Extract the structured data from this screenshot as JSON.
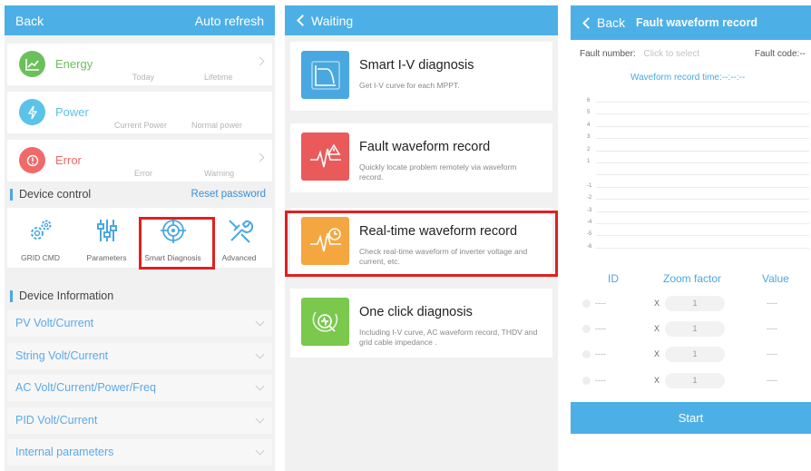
{
  "panel1": {
    "back": "Back",
    "auto_refresh": "Auto refresh",
    "cards": [
      {
        "title": "Energy",
        "sub1": "Today",
        "sub2": "Lifetime",
        "color": "#6cc05c"
      },
      {
        "title": "Power",
        "sub1": "Current Power",
        "sub2": "Normal power",
        "color": "#5bc3e8"
      },
      {
        "title": "Error",
        "sub1": "Error",
        "sub2": "Warning",
        "color": "#f06a6a"
      }
    ],
    "device_control": "Device control",
    "reset_password": "Reset password",
    "tools": [
      {
        "label": "GRID CMD",
        "icon": "gear-icon"
      },
      {
        "label": "Parameters",
        "icon": "sliders-icon"
      },
      {
        "label": "Smart Diagnosis",
        "icon": "target-icon"
      },
      {
        "label": "Advanced",
        "icon": "wrench-icon"
      }
    ],
    "device_information": "Device Information",
    "info_rows": [
      "PV Volt/Current",
      "String Volt/Current",
      "AC Volt/Current/Power/Freq",
      "PID Volt/Current",
      "Internal parameters"
    ]
  },
  "panel2": {
    "back": "Waiting",
    "items": [
      {
        "title": "Smart I-V diagnosis",
        "desc": "Get I-V curve for each MPPT.",
        "color": "#4aa8e0",
        "icon": "iv-curve-icon"
      },
      {
        "title": "Fault waveform record",
        "desc": "Quickly locate problem remotely via waveform record.",
        "color": "#ea5a5a",
        "icon": "fault-waveform-icon"
      },
      {
        "title": "Real-time waveform record",
        "desc": "Check real-time waveform of inverter voltage and current, etc.",
        "color": "#f4a640",
        "icon": "realtime-waveform-icon"
      },
      {
        "title": "One click diagnosis",
        "desc": "Including I-V curve, AC waveform record, THDV and grid cable impedance .",
        "color": "#7ac84c",
        "icon": "search-icon"
      }
    ]
  },
  "panel3": {
    "back": "Back",
    "title": "Fault waveform record",
    "fault_number_label": "Fault number:",
    "fault_number_placeholder": "Click to select",
    "fault_code_label": "Fault code:--",
    "waveform_time": "Waveform record time:--:--:--",
    "y_ticks": [
      "6",
      "5",
      "4",
      "3",
      "2",
      "1",
      "",
      "-1",
      "-2",
      "-3",
      "-4",
      "-5",
      "-6"
    ],
    "col_id": "ID",
    "col_zoom": "Zoom factor",
    "col_value": "Value",
    "rows": [
      {
        "id": "----",
        "x": "X",
        "zoom": "1",
        "value": "----"
      },
      {
        "id": "----",
        "x": "X",
        "zoom": "1",
        "value": "----"
      },
      {
        "id": "----",
        "x": "X",
        "zoom": "1",
        "value": "----"
      },
      {
        "id": "----",
        "x": "X",
        "zoom": "1",
        "value": "----"
      }
    ],
    "start": "Start"
  },
  "colors": {
    "accent": "#4cb0e6",
    "highlight": "#e02020"
  }
}
